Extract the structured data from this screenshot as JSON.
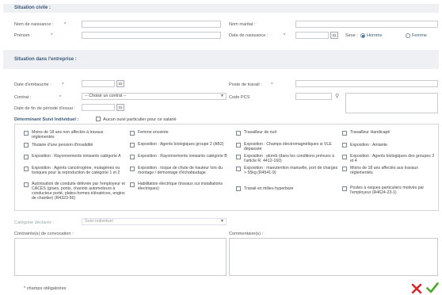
{
  "civil": {
    "title": "Situation civile :",
    "nom_naissance": "Nom de naissance :",
    "prenom": "Prénom :",
    "nom_marital": "Nom marital :",
    "date_naissance": "Date de naissance :",
    "sexe": "Sexe :",
    "homme": "Homme",
    "femme": "Femme",
    "req": "*"
  },
  "entreprise": {
    "title": "Situation dans l'entreprise :",
    "date_embauche": "Date d'embauche :",
    "contrat": "Contrat :",
    "contrat_value": "-- Choisir un contrat --",
    "date_fin": "Date de fin de période d'essai :",
    "poste": "Poste de travail :",
    "code_pcs": "Code PCS",
    "req": "*"
  },
  "suivi": {
    "title": "Déterminant Suivi Individuel :",
    "aucun": "Aucun suivi particulier pour ce salarié",
    "col1": [
      "Moins de 18 ans non affectés à travaux réglementés",
      "Titulaire d'une pension d'invalidité",
      "Exposition : Rayonnements ionisants catégorie A",
      "Exposition : Agents cancérogène, mutagènes ou toxiques pour la reproduction de catégorie 1 et 2",
      "Autorisation de conduite délivrée par l'employeur et CACES (grues, ponts, chariots automoteurs à conducteur porté, plates-formes élévatrices, engins de chantier) (R4323-56)"
    ],
    "col2": [
      "Femme enceinte",
      "Exposition : Agents biologiques groupe 2 (AB2)",
      "Exposition : Rayonnements ionisants catégorie B",
      "Exposition : risque de chute de hauteur lors du montage / démontage d'échafaudage",
      "Habilitation électrique (travaux sur installations électriques)"
    ],
    "col3": [
      "Travailleur de nuit",
      "Exposition : Champs électromagnétiques si VLE dépassée",
      "Exposition : plomb (dans les conditions prévues à l'article R. 4412-160)",
      "Exposition : manutention manuelle, port de charges > 55kg (R4541-9)",
      "Travail en milieu hyperbare"
    ],
    "col4": [
      "Travailleur Handicapé",
      "Exposition : Amiante",
      "Exposition : Agents biologiques des groupes 3 et 4",
      "Moins de 18 ans affectés aux travaux réglementés",
      "Postes à risques particuliers motivés par l'employeur (R4624-23-1)"
    ],
    "categorie_label": "Catégorie déclarée :",
    "categorie_value": "Suivi individuel"
  },
  "bottom": {
    "contraintes": "Contrainte(s) de convocation :",
    "commentaires": "Commentaire(s) :",
    "footnote": "* champs obligatoires",
    "cancel_icon": "cancel-x-icon",
    "confirm_icon": "confirm-check-icon"
  },
  "colors": {
    "section_bg": "#eef0f3",
    "section_text": "#3b5b7b",
    "cancel": "#d8262c",
    "confirm": "#4caa2a"
  }
}
